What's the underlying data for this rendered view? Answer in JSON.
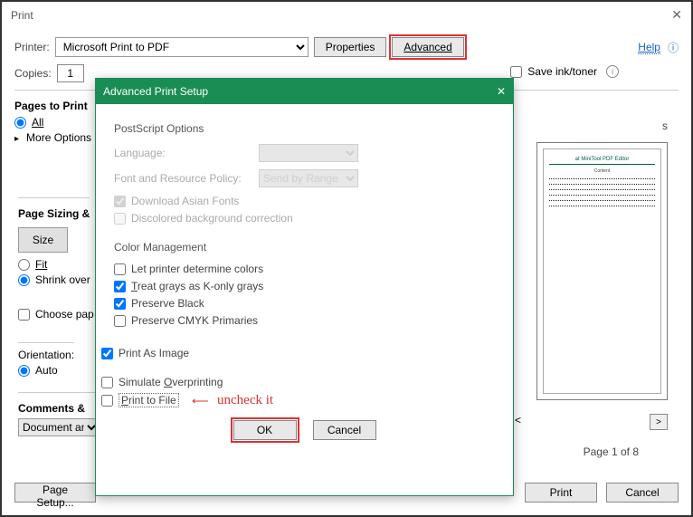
{
  "print_dialog": {
    "title": "Print",
    "printer_label": "Printer:",
    "printer_value": "Microsoft Print to PDF",
    "properties_btn": "Properties",
    "advanced_btn": "Advanced",
    "help_link": "Help",
    "copies_label": "Copies:",
    "copies_value": "1",
    "save_ink_label": "Save ink/toner",
    "pages_to_print": "Pages to Print",
    "all_label": "All",
    "more_options": "More Options",
    "page_sizing": "Page Sizing &",
    "size_btn": "Size",
    "fit_label": "Fit",
    "shrink_label": "Shrink over",
    "choose_paper": "Choose pap",
    "orientation_label": "Orientation:",
    "auto_label": "Auto",
    "comments_label": "Comments &",
    "comments_select": "Document an",
    "preview_header": "s",
    "preview_title1": "at MiniTool PDF Editor",
    "preview_title2": "Content",
    "page_nav": "Page 1 of 8",
    "page_setup_btn": "Page Setup...",
    "print_btn": "Print",
    "cancel_btn": "Cancel",
    "nav_prev": "<",
    "nav_next": ">"
  },
  "advanced_dialog": {
    "title": "Advanced Print Setup",
    "postscript_title": "PostScript Options",
    "language_label": "Language:",
    "font_policy_label": "Font and Resource Policy:",
    "font_policy_value": "Send by Range",
    "download_asian": "Download Asian Fonts",
    "discolored_bg": "Discolored background correction",
    "color_mgmt_title": "Color Management",
    "let_printer": "Let printer determine colors",
    "treat_grays_pre": "T",
    "treat_grays": "reat grays as K-only grays",
    "preserve_black": "Preserve Black",
    "preserve_cmyk": "Preserve CMYK Primaries",
    "print_as_image": "Print As Image",
    "simulate_over_pre": "Simulate ",
    "simulate_over_under": "O",
    "simulate_over_post": "verprinting",
    "print_to_file_pre": "P",
    "print_to_file": "rint to File",
    "annot_text": "uncheck it",
    "ok_btn": "OK",
    "cancel_btn": "Cancel"
  }
}
